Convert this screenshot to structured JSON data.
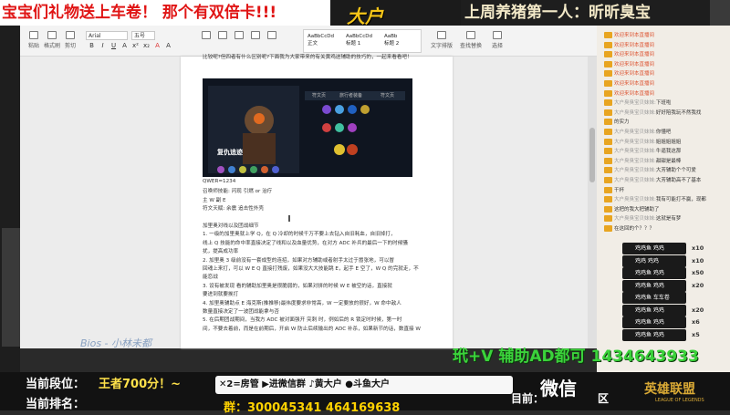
{
  "top_banner": {
    "left": "宝宝们礼物送上车卷！ 那个有双倍卡!!!",
    "logo": "大户",
    "right": "上周养猪第一人：昕昕臭宝"
  },
  "ribbon": {
    "buttons": [
      "粘贴",
      "格式刷",
      "剪切",
      "复制"
    ],
    "font_name": "Arial",
    "font_size": "五号",
    "format_buttons": [
      "B",
      "I",
      "U",
      "A",
      "x²",
      "x₂",
      "A",
      "A"
    ],
    "styles": [
      "AaBbCcDd",
      "AaBbCcDd",
      "AaBb"
    ],
    "style_labels": [
      "正文",
      "标题 1",
      "标题 2"
    ],
    "right_buttons": [
      "文字排版",
      "查找替换",
      "选择"
    ]
  },
  "document": {
    "intro_line": "比较呢?但四者有什么区别呢?下面我为大家带来的有关黄鸡送辅助的技巧的，一起来看看吧！",
    "lines": [
      "QWER=1234",
      "召唤师技能: 闪现 引燃 or 治疗",
      "主 W 副 E",
      "符文天赋: 余震 追击性外壳",
      "",
      "加里奥对线以及团战细节",
      "1.   一级的加里奥就上学 Q，在 Q 冷却的时候千万不要上去钻入自旧耗血，自旧掉打，",
      "线上 Q 技能的命中率直接决定了线和以及血量优势，在对方 ADC 补兵的最后一下的时候骚",
      "扰，提高成功率",
      "2.   加里奥 3 级前没有一套成型的连招，如果对方辅助或者射手太过于嚣张地，可以冒",
      "回魂上来打，可以 W E Q 直接打残废，如果没大大技能跳 E，起手 E 空了，W Q 的完就走，不",
      "能恋战",
      "3.   设有被发现 看的辅助加里奥是很脆弱的，如果对拼的时候 W E 被空的话，直接就",
      "要进到就要挨打",
      "4.   加里奥辅助点 E 海克斯(推推移)最伟度要求非常高，W 一定要放的很好，W 命中敌人",
      "数量直接决定了一波团战能拿与否",
      "5.   在后期团战期间，当我方 ADC 被对面强开 突刺 时，例如后的 R 锁定时时候，第一时",
      "间，不要去着前，而是在前期后，开启 W 防止后续输出的 ADC 补杀，如果新节的话，数直接 W"
    ],
    "image_caption": "复仇追迹",
    "image_tabs": [
      "符文页",
      "旅行者装备",
      "符文页"
    ]
  },
  "chat": {
    "rows": [
      {
        "user": "",
        "msg": "欢迎来到本直播间",
        "sys": true
      },
      {
        "user": "",
        "msg": "欢迎来到本直播间",
        "sys": true
      },
      {
        "user": "",
        "msg": "欢迎来到本直播间",
        "sys": true
      },
      {
        "user": "",
        "msg": "欢迎来到本直播间",
        "sys": true
      },
      {
        "user": "",
        "msg": "欢迎来到本直播间",
        "sys": true
      },
      {
        "user": "",
        "msg": "欢迎来到本直播间",
        "sys": true
      },
      {
        "user": "",
        "msg": "欢迎来到本直播间",
        "sys": true
      },
      {
        "user": "大户臭臭宝贝妹妹:",
        "msg": "下班啦",
        "sys": false
      },
      {
        "user": "大户臭臭宝贝妹妹:",
        "msg": "好好陪我玩不然我找",
        "sys": false
      },
      {
        "user": "",
        "msg": "的实力",
        "sys": false
      },
      {
        "user": "大户臭臭宝贝妹妹:",
        "msg": "你懂吧",
        "sys": false
      },
      {
        "user": "大户臭臭宝贝妹妹:",
        "msg": "姐姐姐姐姐",
        "sys": false
      },
      {
        "user": "大户臭臭宝贝妹妹:",
        "msg": "牛逼我这那",
        "sys": false
      },
      {
        "user": "大户臭臭宝贝妹妹:",
        "msg": "甜甜是最棒",
        "sys": false
      },
      {
        "user": "大户臭臭宝贝妹妹:",
        "msg": "大芳辅助个个可爱",
        "sys": false
      },
      {
        "user": "大户臭臭宝贝妹妹:",
        "msg": "大芳辅助高不了基本",
        "sys": false
      },
      {
        "user": "",
        "msg": "干杯",
        "sys": false
      },
      {
        "user": "大户臭臭宝贝妹妹:",
        "msg": "我有可能打不赢，现都",
        "sys": false
      },
      {
        "user": "",
        "msg": "这把的我大把辅助了",
        "sys": false
      },
      {
        "user": "大户臭臭宝贝妹妹:",
        "msg": "这就是有梦",
        "sys": false
      },
      {
        "user": "",
        "msg": "在这回的个？？？",
        "sys": false
      }
    ],
    "gifts": [
      {
        "name": "鸡鸡鱼 鸡鸡",
        "count": "x10"
      },
      {
        "name": "鸡鸡 鸡鸡",
        "count": "x10"
      },
      {
        "name": "鸡鸡鱼 鸡鸡",
        "count": "x50"
      },
      {
        "name": "鸡鸡鱼 鸡鸡",
        "count": "x20"
      },
      {
        "name": "鸡鸡鱼 车车卷",
        "count": ""
      },
      {
        "name": "鸡鸡鱼 鸡鸡",
        "count": "x20"
      },
      {
        "name": "鸡鸡鱼 鸡鸡",
        "count": "x6"
      },
      {
        "name": "鸡鸡鱼 鸡鸡",
        "count": "x5"
      }
    ]
  },
  "overlay": {
    "watermark": "Bios - 小林未都",
    "contact": "玳+V 辅助AD都可 1434643933",
    "rank_label": "当前段位：",
    "rank_value": "王者700分！~",
    "rank_now": "当前排名：",
    "promo": "✕2=房管 ▶进微信群 ♪黄大户 ●斗鱼大户",
    "qq": "群：300045341 464169638",
    "current": "目前：",
    "weixin": "微信",
    "area": "区",
    "lol_title": "英雄联盟",
    "lol_sub": "LEAGUE OF LEGENDS"
  }
}
